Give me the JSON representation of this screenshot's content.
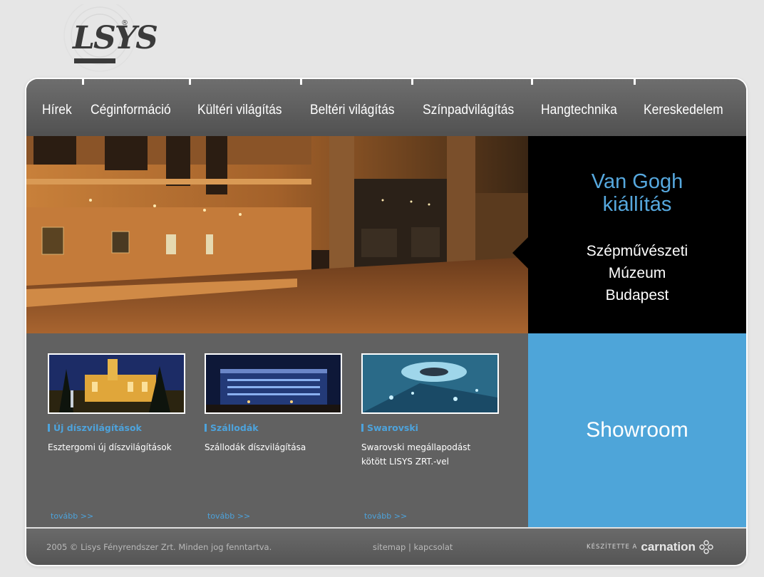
{
  "brand": {
    "logo_text": "LSYS",
    "registered_mark": "®"
  },
  "nav": {
    "items": [
      {
        "label": "Hírek"
      },
      {
        "label": "Céginformáció"
      },
      {
        "label": "Kültéri világítás"
      },
      {
        "label": "Beltéri világítás"
      },
      {
        "label": "Színpadvilágítás"
      },
      {
        "label": "Hangtechnika"
      },
      {
        "label": "Kereskedelem"
      }
    ]
  },
  "promo": {
    "title_line1": "Van Gogh",
    "title_line2": "kiállítás",
    "sub_line1": "Szépművészeti",
    "sub_line2": "Múzeum",
    "sub_line3": "Budapest"
  },
  "cards": [
    {
      "title": "Új díszvilágítások",
      "desc_line1": "Esztergomi új díszvilágítások",
      "desc_line2": "",
      "more": "tovább >>"
    },
    {
      "title": "Szállodák",
      "desc_line1": "Szállodák díszvilágítása",
      "desc_line2": "",
      "more": "tovább >>"
    },
    {
      "title": "Swarovski",
      "desc_line1": "Swarovski megállapodást",
      "desc_line2": "kötött LISYS ZRT.-vel",
      "more": "tovább >>"
    }
  ],
  "showroom": {
    "label": "Showroom"
  },
  "footer": {
    "copyright": "2005 © Lisys Fényrendszer Zrt. Minden jog fenntartva.",
    "sitemap": "sitemap",
    "separator": "|",
    "contact": "kapcsolat",
    "credit_label": "KÉSZÍTETTE A",
    "credit_brand": "carnation"
  },
  "colors": {
    "accent_blue": "#4ea5d9",
    "panel_gray": "#616161",
    "promo_black": "#000000"
  }
}
